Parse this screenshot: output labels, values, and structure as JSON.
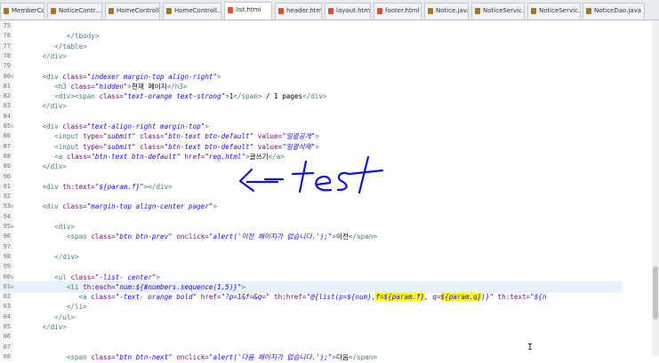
{
  "tabs": [
    {
      "label": "MemberContr...",
      "icon": "java-file-icon",
      "color": "#b07219"
    },
    {
      "label": "NoticeContr...",
      "icon": "java-file-icon",
      "color": "#b07219"
    },
    {
      "label": "HomeControll...",
      "icon": "java-file-icon",
      "color": "#b07219"
    },
    {
      "label": "HomeControll...",
      "icon": "java-file-icon",
      "color": "#b07219"
    },
    {
      "label": "list.html",
      "icon": "html-file-icon",
      "color": "#e44d26",
      "active": true
    },
    {
      "label": "header.html",
      "icon": "html-file-icon",
      "color": "#e44d26"
    },
    {
      "label": "layout.html",
      "icon": "html-file-icon",
      "color": "#e44d26"
    },
    {
      "label": "footer.html",
      "icon": "html-file-icon",
      "color": "#e44d26"
    },
    {
      "label": "Notice.java",
      "icon": "java-file-icon",
      "color": "#b07219"
    },
    {
      "label": "NoticeServic...",
      "icon": "java-file-icon",
      "color": "#b07219"
    },
    {
      "label": "NoticeServic...",
      "icon": "java-file-icon",
      "color": "#b07219"
    },
    {
      "label": "NoticeDao.java",
      "icon": "java-file-icon",
      "color": "#b07219"
    }
  ],
  "lines": [
    {
      "n": "75",
      "fold": "",
      "segs": []
    },
    {
      "n": "76",
      "fold": "",
      "segs": [
        [
          "x",
          "            "
        ],
        [
          "t",
          "</tbody>"
        ]
      ]
    },
    {
      "n": "77",
      "fold": "",
      "segs": [
        [
          "x",
          "         "
        ],
        [
          "t",
          "</table>"
        ]
      ]
    },
    {
      "n": "78",
      "fold": "",
      "segs": [
        [
          "x",
          "      "
        ],
        [
          "t",
          "</div>"
        ]
      ]
    },
    {
      "n": "79",
      "fold": "",
      "segs": []
    },
    {
      "n": "80",
      "fold": "⊖",
      "segs": [
        [
          "x",
          "      "
        ],
        [
          "t",
          "<div "
        ],
        [
          "a",
          "class="
        ],
        [
          "s",
          "\"indexer margin-top align-right\""
        ],
        [
          "t",
          ">"
        ]
      ]
    },
    {
      "n": "81",
      "fold": "",
      "segs": [
        [
          "x",
          "         "
        ],
        [
          "t",
          "<h3 "
        ],
        [
          "a",
          "class="
        ],
        [
          "s",
          "\"hidden\""
        ],
        [
          "t",
          ">"
        ],
        [
          "x",
          "현재 페이지"
        ],
        [
          "t",
          "</h3>"
        ]
      ]
    },
    {
      "n": "82",
      "fold": "",
      "segs": [
        [
          "x",
          "         "
        ],
        [
          "t",
          "<div><span "
        ],
        [
          "a",
          "class="
        ],
        [
          "s",
          "\"text-orange text-strong\""
        ],
        [
          "t",
          ">"
        ],
        [
          "x",
          "1"
        ],
        [
          "t",
          "</span>"
        ],
        [
          "x",
          " / 1 pages"
        ],
        [
          "t",
          "</div>"
        ]
      ]
    },
    {
      "n": "83",
      "fold": "",
      "segs": [
        [
          "x",
          "      "
        ],
        [
          "t",
          "</div>"
        ]
      ]
    },
    {
      "n": "84",
      "fold": "",
      "segs": []
    },
    {
      "n": "85",
      "fold": "⊖",
      "segs": [
        [
          "x",
          "      "
        ],
        [
          "t",
          "<div "
        ],
        [
          "a",
          "class="
        ],
        [
          "s",
          "\"text-align-right margin-top\""
        ],
        [
          "t",
          ">"
        ]
      ]
    },
    {
      "n": "86",
      "fold": "",
      "segs": [
        [
          "x",
          "         "
        ],
        [
          "t",
          "<input "
        ],
        [
          "a",
          "type="
        ],
        [
          "s",
          "\"submit\""
        ],
        [
          "a",
          " class="
        ],
        [
          "s",
          "\"btn-text btn-default\""
        ],
        [
          "a",
          " value="
        ],
        [
          "s",
          "\"일괄공개\""
        ],
        [
          "t",
          ">"
        ]
      ]
    },
    {
      "n": "87",
      "fold": "",
      "segs": [
        [
          "x",
          "         "
        ],
        [
          "t",
          "<input "
        ],
        [
          "a",
          "type="
        ],
        [
          "s",
          "\"submit\""
        ],
        [
          "a",
          " class="
        ],
        [
          "s",
          "\"btn-text btn-default\""
        ],
        [
          "a",
          " value="
        ],
        [
          "s",
          "\"일괄삭제\""
        ],
        [
          "t",
          ">"
        ]
      ]
    },
    {
      "n": "88",
      "fold": "",
      "segs": [
        [
          "x",
          "         "
        ],
        [
          "t",
          "<a "
        ],
        [
          "a",
          "class="
        ],
        [
          "s",
          "\"btn-text btn-default\""
        ],
        [
          "a",
          " href="
        ],
        [
          "s",
          "\"reg.html\""
        ],
        [
          "t",
          ">"
        ],
        [
          "x",
          "글쓰기"
        ],
        [
          "t",
          "</a>"
        ]
      ]
    },
    {
      "n": "89",
      "fold": "",
      "segs": [
        [
          "x",
          "      "
        ],
        [
          "t",
          "</div>"
        ]
      ]
    },
    {
      "n": "90",
      "fold": "",
      "segs": []
    },
    {
      "n": "91",
      "fold": "",
      "segs": [
        [
          "x",
          "      "
        ],
        [
          "t",
          "<div "
        ],
        [
          "a",
          "th:text="
        ],
        [
          "s",
          "\"${param.f}\""
        ],
        [
          "t",
          "></div>"
        ]
      ]
    },
    {
      "n": "92",
      "fold": "",
      "segs": []
    },
    {
      "n": "93",
      "fold": "⊖",
      "segs": [
        [
          "x",
          "      "
        ],
        [
          "t",
          "<div "
        ],
        [
          "a",
          "class="
        ],
        [
          "s",
          "\"margin-top align-center pager\""
        ],
        [
          "t",
          ">"
        ]
      ]
    },
    {
      "n": "94",
      "fold": "",
      "segs": []
    },
    {
      "n": "95",
      "fold": "⊖",
      "segs": [
        [
          "x",
          "         "
        ],
        [
          "t",
          "<div>"
        ]
      ]
    },
    {
      "n": "96",
      "fold": "",
      "segs": [
        [
          "x",
          "            "
        ],
        [
          "t",
          "<span "
        ],
        [
          "a",
          "class="
        ],
        [
          "s",
          "\"btn btn-prev\""
        ],
        [
          "a",
          " onclick="
        ],
        [
          "s",
          "\"alert('이전 페이지가 없습니다.');\""
        ],
        [
          "t",
          ">"
        ],
        [
          "x",
          "이전"
        ],
        [
          "t",
          "</span>"
        ]
      ]
    },
    {
      "n": "97",
      "fold": "",
      "segs": []
    },
    {
      "n": "98",
      "fold": "",
      "segs": [
        [
          "x",
          "         "
        ],
        [
          "t",
          "</div>"
        ]
      ]
    },
    {
      "n": "99",
      "fold": "",
      "segs": []
    },
    {
      "n": "00",
      "fold": "⊖",
      "segs": [
        [
          "x",
          "         "
        ],
        [
          "t",
          "<ul "
        ],
        [
          "a",
          "class="
        ],
        [
          "s",
          "\"-list- center\""
        ],
        [
          "t",
          ">"
        ]
      ]
    },
    {
      "n": "01",
      "fold": "⊖",
      "current": true,
      "segs": [
        [
          "x",
          "            "
        ],
        [
          "t",
          "<li "
        ],
        [
          "a",
          "th:each="
        ],
        [
          "s",
          "\"num:${#numbers.sequence(1,5)}\""
        ],
        [
          "t",
          ">"
        ]
      ]
    },
    {
      "n": "02",
      "fold": "",
      "segs": [
        [
          "x",
          "               "
        ],
        [
          "t",
          "<a "
        ],
        [
          "a",
          "class="
        ],
        [
          "s",
          "\"-text- orange bold\""
        ],
        [
          "a",
          " href="
        ],
        [
          "s",
          "\"?p=1&f=&q=\""
        ],
        [
          "a",
          " th:href="
        ],
        [
          "s",
          "\"@{list(p=${num},"
        ],
        [
          "hl",
          "f=${param.f}"
        ],
        [
          "s",
          ", q="
        ],
        [
          "hl",
          "${param.q}"
        ],
        [
          "s",
          ")}\""
        ],
        [
          "a",
          " th:text="
        ],
        [
          "s",
          "\"${n"
        ]
      ]
    },
    {
      "n": "03",
      "fold": "",
      "segs": [
        [
          "x",
          "            "
        ],
        [
          "t",
          "</li>"
        ]
      ]
    },
    {
      "n": "04",
      "fold": "",
      "segs": [
        [
          "x",
          "         "
        ],
        [
          "t",
          "</ul>"
        ]
      ]
    },
    {
      "n": "05",
      "fold": "",
      "segs": [
        [
          "x",
          "      "
        ],
        [
          "t",
          "</div>"
        ]
      ]
    },
    {
      "n": "06",
      "fold": "",
      "segs": []
    },
    {
      "n": "07",
      "fold": "",
      "segs": []
    },
    {
      "n": "08",
      "fold": "",
      "segs": [
        [
          "x",
          "            "
        ],
        [
          "t",
          "<span "
        ],
        [
          "a",
          "class="
        ],
        [
          "s",
          "\"btn btn-next\""
        ],
        [
          "a",
          " onclick="
        ],
        [
          "s",
          "\"alert('다음 페이지가 없습니다.');\""
        ],
        [
          "t",
          ">"
        ],
        [
          "x",
          "다음"
        ],
        [
          "t",
          "</span>"
        ]
      ]
    }
  ],
  "annotation": {
    "text": "test",
    "color": "#1010e0"
  }
}
